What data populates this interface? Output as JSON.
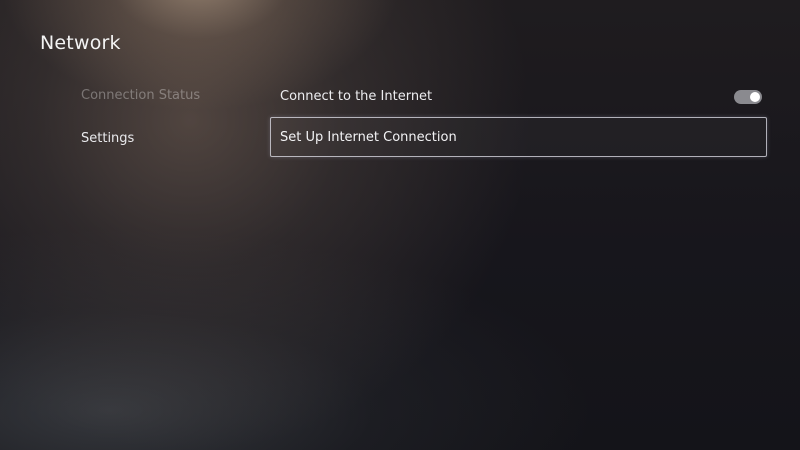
{
  "page": {
    "title": "Network"
  },
  "sidebar": {
    "items": [
      {
        "label": "Connection Status",
        "state": "dimmed"
      },
      {
        "label": "Settings",
        "state": "selected"
      }
    ]
  },
  "settings": {
    "connect_internet": {
      "label": "Connect to the Internet",
      "toggle_on": true
    },
    "setup_connection": {
      "label": "Set Up Internet Connection",
      "focused": true
    }
  },
  "colors": {
    "background": "#15151b",
    "toggle_track": "#8a8a8f",
    "toggle_knob": "#ffffff",
    "focus_border": "#e1e1eb"
  }
}
